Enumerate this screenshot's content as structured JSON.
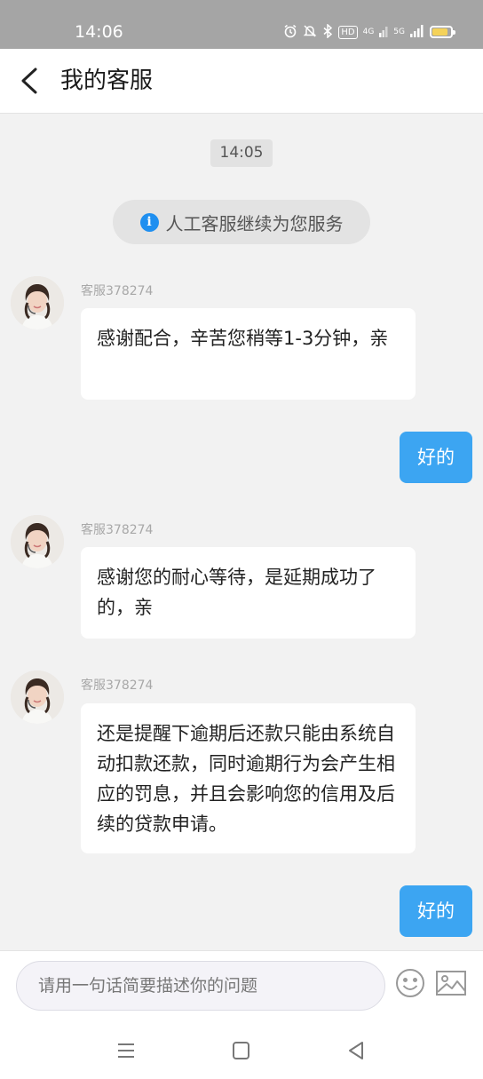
{
  "status_bar": {
    "time": "14:06",
    "hd_badge": "HD",
    "network_4g": "4G",
    "network_5g": "5G",
    "battery_level": 0.85,
    "battery_color": "#f4d25a"
  },
  "header": {
    "title": "我的客服"
  },
  "chat": {
    "timestamp": "14:05",
    "system_notice": "人工客服继续为您服务",
    "messages": [
      {
        "from": "agent",
        "name": "客服378274",
        "text": "感谢配合，辛苦您稍等1-3分钟，亲"
      },
      {
        "from": "user",
        "text": "好的"
      },
      {
        "from": "agent",
        "name": "客服378274",
        "text": "感谢您的耐心等待，是延期成功了的，亲"
      },
      {
        "from": "agent",
        "name": "客服378274",
        "text": "还是提醒下逾期后还款只能由系统自动扣款还款，同时逾期行为会产生相应的罚息，并且会影响您的信用及后续的贷款申请。"
      },
      {
        "from": "user",
        "text": "好的"
      }
    ]
  },
  "input_bar": {
    "placeholder": "请用一句话简要描述你的问题",
    "icons": [
      "emoji-icon",
      "image-icon"
    ]
  },
  "nav_bar": {
    "icons": [
      "menu-icon",
      "home-icon",
      "back-triangle-icon"
    ]
  },
  "colors": {
    "accent": "#3ca5f2",
    "info": "#1f8ff0",
    "background": "#f2f2f2"
  }
}
